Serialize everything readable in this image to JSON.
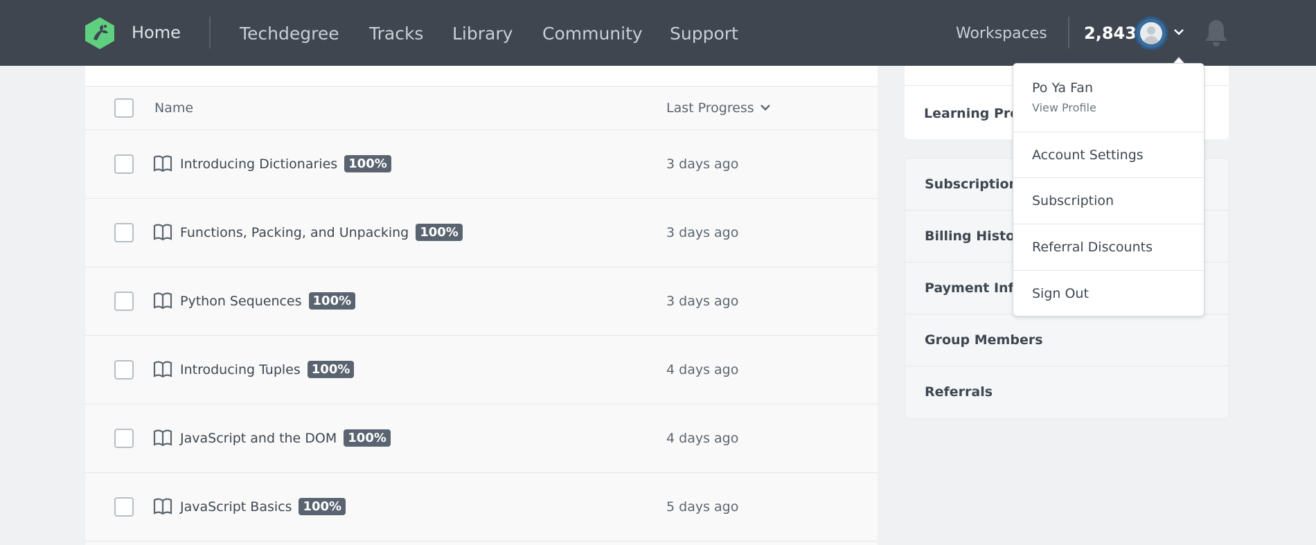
{
  "nav": {
    "home": "Home",
    "links": [
      "Techdegree",
      "Tracks",
      "Library",
      "Community",
      "Support"
    ],
    "workspaces": "Workspaces",
    "points": "2,843"
  },
  "table": {
    "col_name": "Name",
    "col_progress": "Last Progress",
    "rows": [
      {
        "title": "Introducing Dictionaries",
        "badge": "100%",
        "when": "3 days ago"
      },
      {
        "title": "Functions, Packing, and Unpacking",
        "badge": "100%",
        "when": "3 days ago"
      },
      {
        "title": "Python Sequences",
        "badge": "100%",
        "when": "3 days ago"
      },
      {
        "title": "Introducing Tuples",
        "badge": "100%",
        "when": "4 days ago"
      },
      {
        "title": "JavaScript and the DOM",
        "badge": "100%",
        "when": "4 days ago"
      },
      {
        "title": "JavaScript Basics",
        "badge": "100%",
        "when": "5 days ago"
      }
    ]
  },
  "side": {
    "learning": "Learning Prog",
    "items": [
      "Subscription",
      "Billing History",
      "Payment Info",
      "Group Members",
      "Referrals"
    ]
  },
  "dropdown": {
    "name": "Po Ya Fan",
    "view_profile": "View Profile",
    "items": [
      "Account Settings",
      "Subscription",
      "Referral Discounts",
      "Sign Out"
    ]
  },
  "colors": {
    "nav_bg": "#3f4650",
    "logo_green": "#5fcf80",
    "badge_bg": "#5a6470"
  }
}
